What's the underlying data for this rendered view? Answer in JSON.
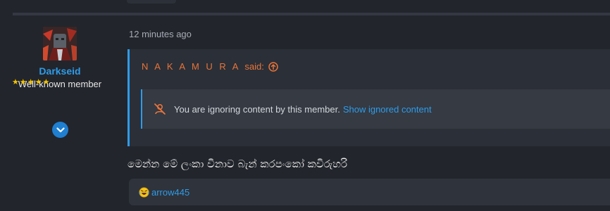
{
  "user": {
    "name": "Darkseid",
    "title": "Well-known member",
    "stars": "★★★★★"
  },
  "post": {
    "timestamp": "12 minutes ago",
    "body": "මෙන්න මේ ලංකා විනාව බැන් කරපංකෝ කවිරුහරි"
  },
  "quote": {
    "author": "N A K A M U R A",
    "said": "said:",
    "ignored_message": "You are ignoring content by this member.",
    "show_link": "Show ignored content"
  },
  "reactions": {
    "users": "arrow445"
  },
  "colors": {
    "accent": "#2f9be8",
    "quote_author": "#e8743a",
    "stars": "#f2c200"
  }
}
